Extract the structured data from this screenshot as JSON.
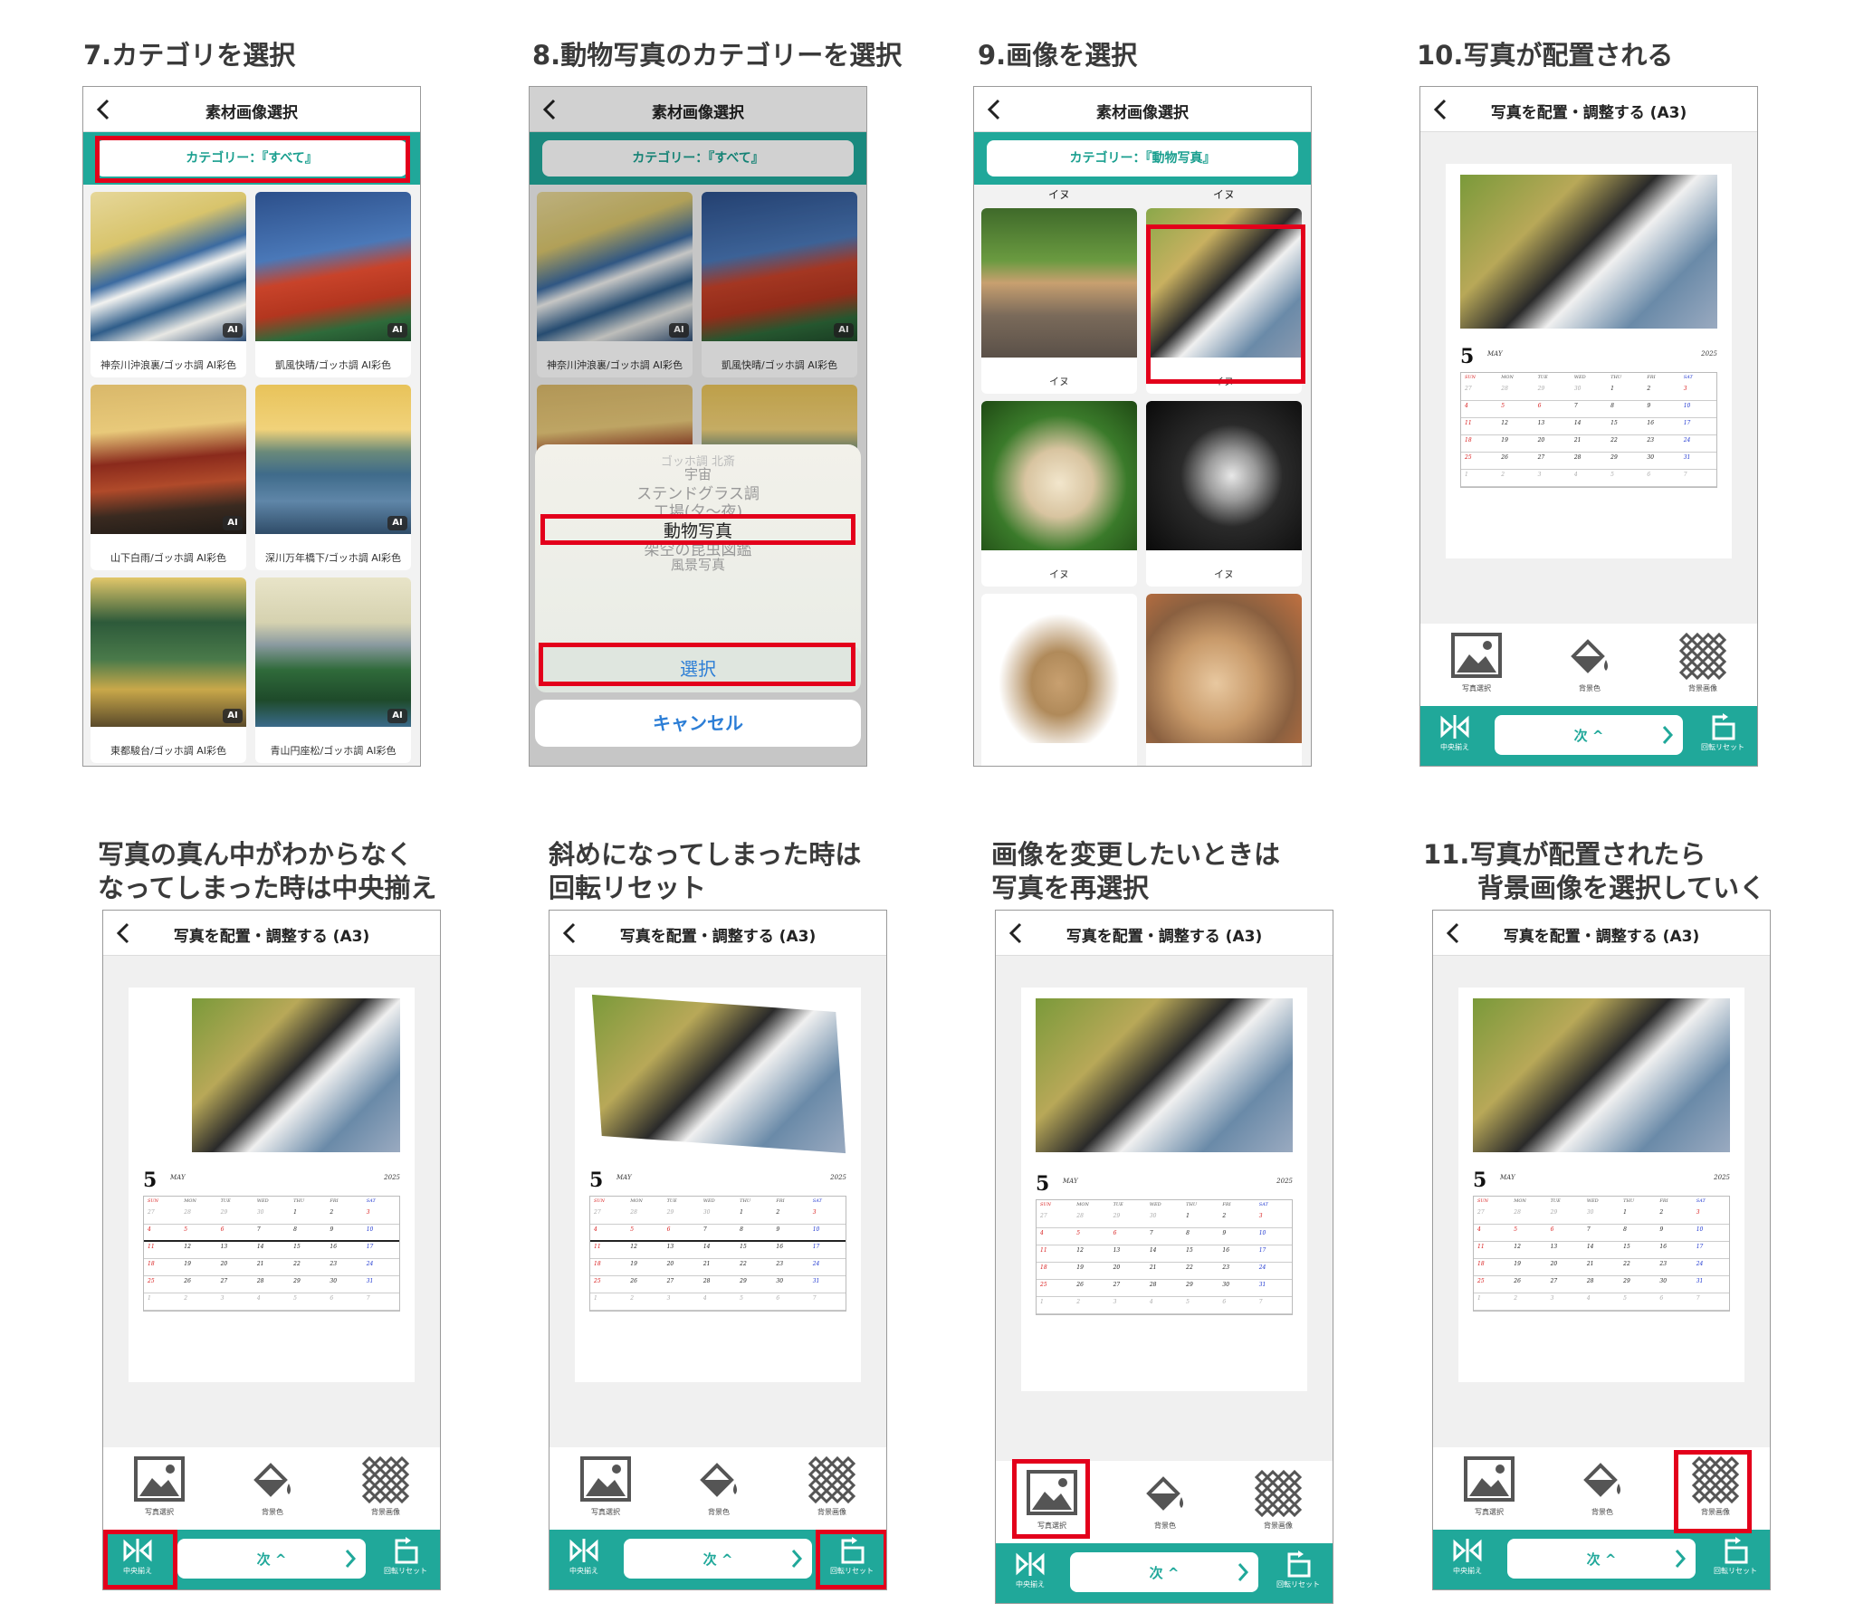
{
  "captions": {
    "c7": "7.カテゴリを選択",
    "c8": "8.動物写真のカテゴリーを選択",
    "c9": "9.画像を選択",
    "c10": "10.写真が配置される",
    "c11_1": "写真の真ん中がわからなく",
    "c11_2": "なってしまった時は中央揃え",
    "c12_1": "斜めになってしまった時は",
    "c12_2": "回転リセット",
    "c13_1": "画像を変更したいときは",
    "c13_2": "写真を再選択",
    "c14_1": "11.写真が配置されたら",
    "c14_2": "背景画像を選択していく"
  },
  "picker": {
    "title": "素材画像選択",
    "category_all": "カテゴリー：『すべて』",
    "category_animal": "カテゴリー：『動物写真』",
    "ai_badge": "AI",
    "items": [
      "神奈川沖浪裏/ゴッホ調 AI彩色",
      "凱風快晴/ゴッホ調 AI彩色",
      "山下白雨/ゴッホ調 AI彩色",
      "深川万年橋下/ゴッホ調 AI彩色",
      "東都駿台/ゴッホ調 AI彩色",
      "青山円座松/ゴッホ調 AI彩色"
    ],
    "wheel": [
      "ゴッホ調 北斎",
      "宇宙",
      "ステンドグラス調",
      "工場(夕〜夜)",
      "動物写真",
      "架空の昆虫図鑑",
      "風景写真"
    ],
    "select": "選択",
    "cancel": "キャンセル",
    "dog": "イヌ"
  },
  "editor": {
    "title": "写真を配置・調整する (A3)",
    "tool_photo": "写真選択",
    "tool_bgcolor": "背景色",
    "tool_bgimage": "背景画像",
    "center": "中央揃え",
    "next": "次 ^",
    "rotate_reset": "回転リセット"
  },
  "calendar": {
    "month": "5",
    "month_name": "MAY",
    "year": "2025",
    "days_head": [
      "SUN",
      "MON",
      "TUE",
      "WED",
      "THU",
      "FRI",
      "SAT"
    ],
    "rows": [
      [
        "27",
        "28",
        "29",
        "30",
        "1",
        "2",
        "3"
      ],
      [
        "4",
        "5",
        "6",
        "7",
        "8",
        "9",
        "10"
      ],
      [
        "11",
        "12",
        "13",
        "14",
        "15",
        "16",
        "17"
      ],
      [
        "18",
        "19",
        "20",
        "21",
        "22",
        "23",
        "24"
      ],
      [
        "25",
        "26",
        "27",
        "28",
        "29",
        "30",
        "31"
      ],
      [
        "1",
        "2",
        "3",
        "4",
        "5",
        "6",
        "7"
      ]
    ]
  },
  "colors": {
    "teal": "#20a89a",
    "highlight": "#e3001b",
    "ios_blue": "#2c7ed6"
  }
}
